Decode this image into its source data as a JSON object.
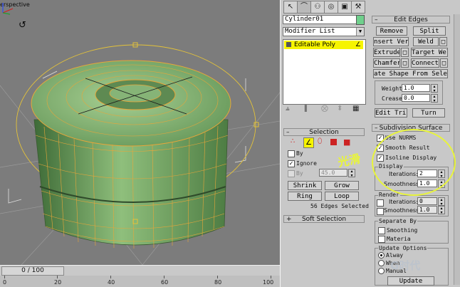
{
  "viewport": {
    "label": "erspective",
    "orbit_icon": "orbit-icon"
  },
  "timeline": {
    "position": "0 / 100",
    "ruler_ticks": [
      "0",
      "20",
      "40",
      "60",
      "80",
      "100"
    ]
  },
  "panel": {
    "tabs": [
      "create-tab",
      "modify-tab",
      "hierarchy-tab",
      "motion-tab",
      "display-tab",
      "utilities-tab"
    ],
    "object_name": "Cylinder01",
    "modifier_list": "Modifier List",
    "stack_item": "Editable Poly",
    "edit_edges": {
      "title": "Edit Edges",
      "remove": "Remove",
      "split": "Split",
      "insert_vertex": "nsert Verte",
      "weld": "Weld",
      "extrude": "Extrude",
      "target_weld": "Target Weld",
      "chamfer": "Chamfer",
      "connect": "Connect",
      "create_shape": "ate Shape From Select",
      "weight_label": "Weight:",
      "weight_value": "1.0",
      "crease_label": "Crease:",
      "crease_value": "0.0",
      "edit_tri": "Edit Tri.",
      "turn": "Turn"
    },
    "selection": {
      "title": "Selection",
      "by_label": "By",
      "ignore_label": "Ignore",
      "by_angle_label": "By",
      "by_angle_value": "45.0",
      "shrink": "Shrink",
      "grow": "Grow",
      "ring": "Ring",
      "loop": "Loop",
      "status": "56 Edges Selected"
    },
    "soft_selection": {
      "title": "Soft Selection"
    },
    "subdivision": {
      "title": "Subdivision Surface",
      "use_nurms": "Use NURMS",
      "smooth_result": "Smooth Result",
      "isoline_display": "Isoline Display",
      "display_group": "Display",
      "iterations_label": "Iterations:",
      "display_iterations": "2",
      "smoothness_label": "Smoothness:",
      "display_smoothness": "1.0",
      "render_group": "Render",
      "render_iterations": "0",
      "render_smoothness": "1.0",
      "separate_by": "Separate By",
      "smoothing": "Smoothing",
      "materia": "Materia",
      "update_options": "Update Options",
      "always": "Alway",
      "when": "When",
      "manual": "Manual",
      "update_button": "Update"
    },
    "annotation": "光滑"
  },
  "watermark": "G时代",
  "colors": {
    "viewport_bg": "#7c7c7c",
    "mesh_green": "#6f9f62",
    "wire_orange": "#e8a63a",
    "highlight_yellow": "#f6f400",
    "panel_bg": "#c8c8c8"
  }
}
